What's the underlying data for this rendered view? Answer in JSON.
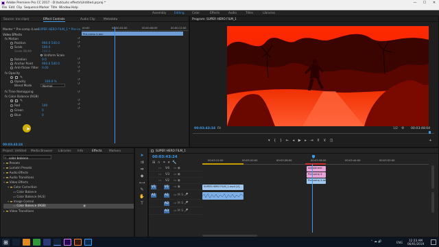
{
  "window": {
    "title": "Adobe Premiere Pro CC 2017 - D:\\tuts\\uhc effects\\Untitled.prproj *",
    "controls": [
      "—",
      "☐",
      "✕"
    ]
  },
  "menu": [
    "File",
    "Edit",
    "Clip",
    "Sequence",
    "Marker",
    "Title",
    "Window",
    "Help"
  ],
  "workspaces": [
    {
      "label": "Assembly",
      "active": false
    },
    {
      "label": "Editing",
      "active": true
    },
    {
      "label": "Color",
      "active": false
    },
    {
      "label": "Effects",
      "active": false
    },
    {
      "label": "Audio",
      "active": false
    },
    {
      "label": "Titles",
      "active": false
    },
    {
      "label": "Libraries",
      "active": false
    }
  ],
  "source_panel": {
    "tabs": [
      "Source: (no clips)",
      "Effect Controls",
      "Audio Clip",
      "Metadata"
    ],
    "active_tab": 1,
    "master": "Master * Pre-comp 4.aec",
    "clip_name": "SUPER HERO FILM_1 * Pre-co...",
    "ruler_times": [
      "00:00",
      "00:00:04:00",
      "00:00:08:00",
      "00:00:12:00",
      "00:00:16:00"
    ],
    "nested_clip_label": "Pre-comp 4.aec",
    "section": "Video Effects",
    "rows": [
      {
        "label": "fx  Motion",
        "value": ""
      },
      {
        "label": "Position",
        "value": "960.0   540.0"
      },
      {
        "label": "Scale",
        "value": "100.0"
      },
      {
        "label": "Scale Width",
        "value": "100.0"
      },
      {
        "label": "",
        "value": "Uniform Scale"
      },
      {
        "label": "Rotation",
        "value": "0.0"
      },
      {
        "label": "Anchor Point",
        "value": "960.0   540.0"
      },
      {
        "label": "Anti-flicker Filter",
        "value": "0.00"
      },
      {
        "label": "fx  Opacity",
        "value": ""
      },
      {
        "label": "",
        "value": ""
      },
      {
        "label": "Opacity",
        "value": "100.0 %"
      },
      {
        "label": "Blend Mode",
        "value": "Normal"
      },
      {
        "label": "fx  Time Remapping",
        "value": ""
      },
      {
        "label": "fx  Color Balance (RGB)",
        "value": ""
      },
      {
        "label": "",
        "value": ""
      },
      {
        "label": "Red",
        "value": "100"
      },
      {
        "label": "Green",
        "value": "0"
      },
      {
        "label": "Blue",
        "value": "0"
      }
    ],
    "footer_time": "00:03:43:24"
  },
  "program_monitor": {
    "title": "Program: SUPER HERO FILM_1",
    "timecode_current": "00:03:43:24",
    "fit": "Fit",
    "resolution": "1/2",
    "timecode_duration": "00:03:48:04"
  },
  "project_panel": {
    "tabs": [
      "Project: Untitled",
      "Media Browser",
      "Libraries",
      "Info",
      "Effects",
      "Markers"
    ],
    "active_tab": 4,
    "search_value": "color balance",
    "tree": [
      {
        "label": "Presets",
        "depth": 0
      },
      {
        "label": "Lumetri Presets",
        "depth": 0
      },
      {
        "label": "Audio Effects",
        "depth": 0
      },
      {
        "label": "Audio Transitions",
        "depth": 0
      },
      {
        "label": "Video Effects",
        "depth": 0
      },
      {
        "label": "Color Correction",
        "depth": 1
      },
      {
        "label": "Color Balance",
        "depth": 2
      },
      {
        "label": "Color Balance (HLS)",
        "depth": 2
      },
      {
        "label": "Image Control",
        "depth": 1
      },
      {
        "label": "Color Balance (RGB)",
        "depth": 2,
        "selected": true
      },
      {
        "label": "Video Transitions",
        "depth": 0
      }
    ]
  },
  "timeline": {
    "tab": "SUPER HERO FILM_1",
    "timecode": "00:03:43:24",
    "ruler": [
      "00:03:12:00",
      "00:03:20:00",
      "00:03:28:00",
      "00:03:36:00",
      "00:03:44:00",
      "00:03:52:00"
    ],
    "video_tracks": [
      "V4",
      "V3",
      "V2",
      "V1"
    ],
    "audio_tracks": [
      "A1",
      "A2",
      "A3"
    ],
    "clips": [
      {
        "label": "Adjustment",
        "track": "V4",
        "color": "#e8a4d8"
      },
      {
        "label": "Pre-comp 4",
        "track": "V3",
        "color": "#e8a4d8"
      },
      {
        "label": "Pre-comp 4.aec",
        "track": "V2",
        "color": "#a3c8f0"
      },
      {
        "label": "SUPER HERO FILM_1.mp4 [V]",
        "track": "V1",
        "color": "#a3c8f0"
      }
    ]
  },
  "tray": {
    "time": "12:23 AM",
    "date": "06/01/2019",
    "lang": "ENG"
  }
}
